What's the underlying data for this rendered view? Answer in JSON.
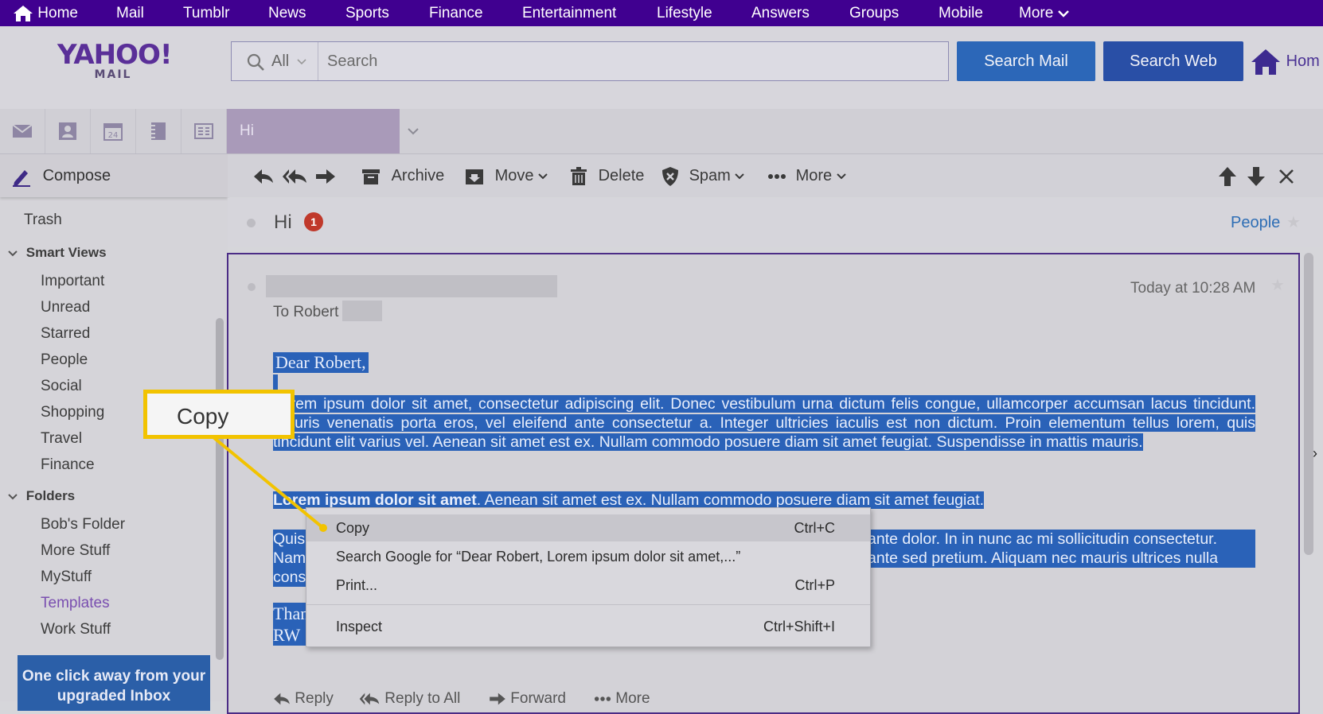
{
  "nav": {
    "home": "Home",
    "items": [
      "Mail",
      "Tumblr",
      "News",
      "Sports",
      "Finance",
      "Entertainment",
      "Lifestyle",
      "Answers",
      "Groups",
      "Mobile"
    ],
    "more": "More"
  },
  "logo": {
    "word": "YAHOO!",
    "sub": "MAIL"
  },
  "search": {
    "scope": "All",
    "placeholder": "Search",
    "search_mail": "Search Mail",
    "search_web": "Search Web",
    "home_link": "Hom"
  },
  "tabs": {
    "open_tab": "Hi"
  },
  "sidebar": {
    "compose": "Compose",
    "trash": "Trash",
    "smart_views_title": "Smart Views",
    "smart_views": [
      "Important",
      "Unread",
      "Starred",
      "People",
      "Social",
      "Shopping",
      "Travel",
      "Finance"
    ],
    "folders_title": "Folders",
    "folders": [
      "Bob's Folder",
      "More Stuff",
      "MyStuff",
      "Templates",
      "Work Stuff"
    ],
    "promo": "One click away from your upgraded Inbox"
  },
  "toolbar": {
    "archive": "Archive",
    "move": "Move",
    "delete": "Delete",
    "spam": "Spam",
    "more": "More"
  },
  "message": {
    "subject": "Hi",
    "badge": "1",
    "people": "People",
    "timestamp": "Today at 10:28 AM",
    "to": "To  Robert",
    "greeting": "Dear Robert,",
    "p1": "Lorem ipsum dolor sit amet, consectetur adipiscing elit. Donec vestibulum urna dictum felis congue, ullamcorper accumsan lacus tincidunt. Mauris venenatis porta eros, vel eleifend ante consectetur a. Integer ultricies iaculis est non dictum. Proin elementum tellus lorem, quis tincidunt elit varius vel. Aenean sit amet est ex. Nullam commodo posuere diam sit amet feugiat. Suspendisse in mattis mauris.",
    "p2_bold": "Lorem ipsum dolor sit amet",
    "p2_rest": ". Aenean sit amet est ex. Nullam commodo posuere diam sit amet feugiat.",
    "p3_right_1": "ante dolor. In in nunc ac mi sollicitudin consectetur.",
    "p3_right_2": "ante sed pretium. Aliquam nec mauris ultrices nulla",
    "p3_left": [
      "Quis",
      "Nam",
      "cons"
    ],
    "sign": [
      "Than",
      "RW"
    ],
    "reply": [
      "Reply",
      "Reply to All",
      "Forward",
      "More"
    ]
  },
  "context_menu": {
    "items": [
      {
        "label": "Copy",
        "shortcut": "Ctrl+C"
      },
      {
        "label": "Search Google for “Dear Robert,  Lorem ipsum dolor sit amet,...”",
        "shortcut": ""
      },
      {
        "label": "Print...",
        "shortcut": "Ctrl+P"
      },
      {
        "label": "Inspect",
        "shortcut": "Ctrl+Shift+I"
      }
    ]
  },
  "callout": {
    "text": "Copy"
  },
  "colors": {
    "nav_bg": "#400090",
    "selection": "#2a62b8",
    "callout": "#f2c300"
  }
}
